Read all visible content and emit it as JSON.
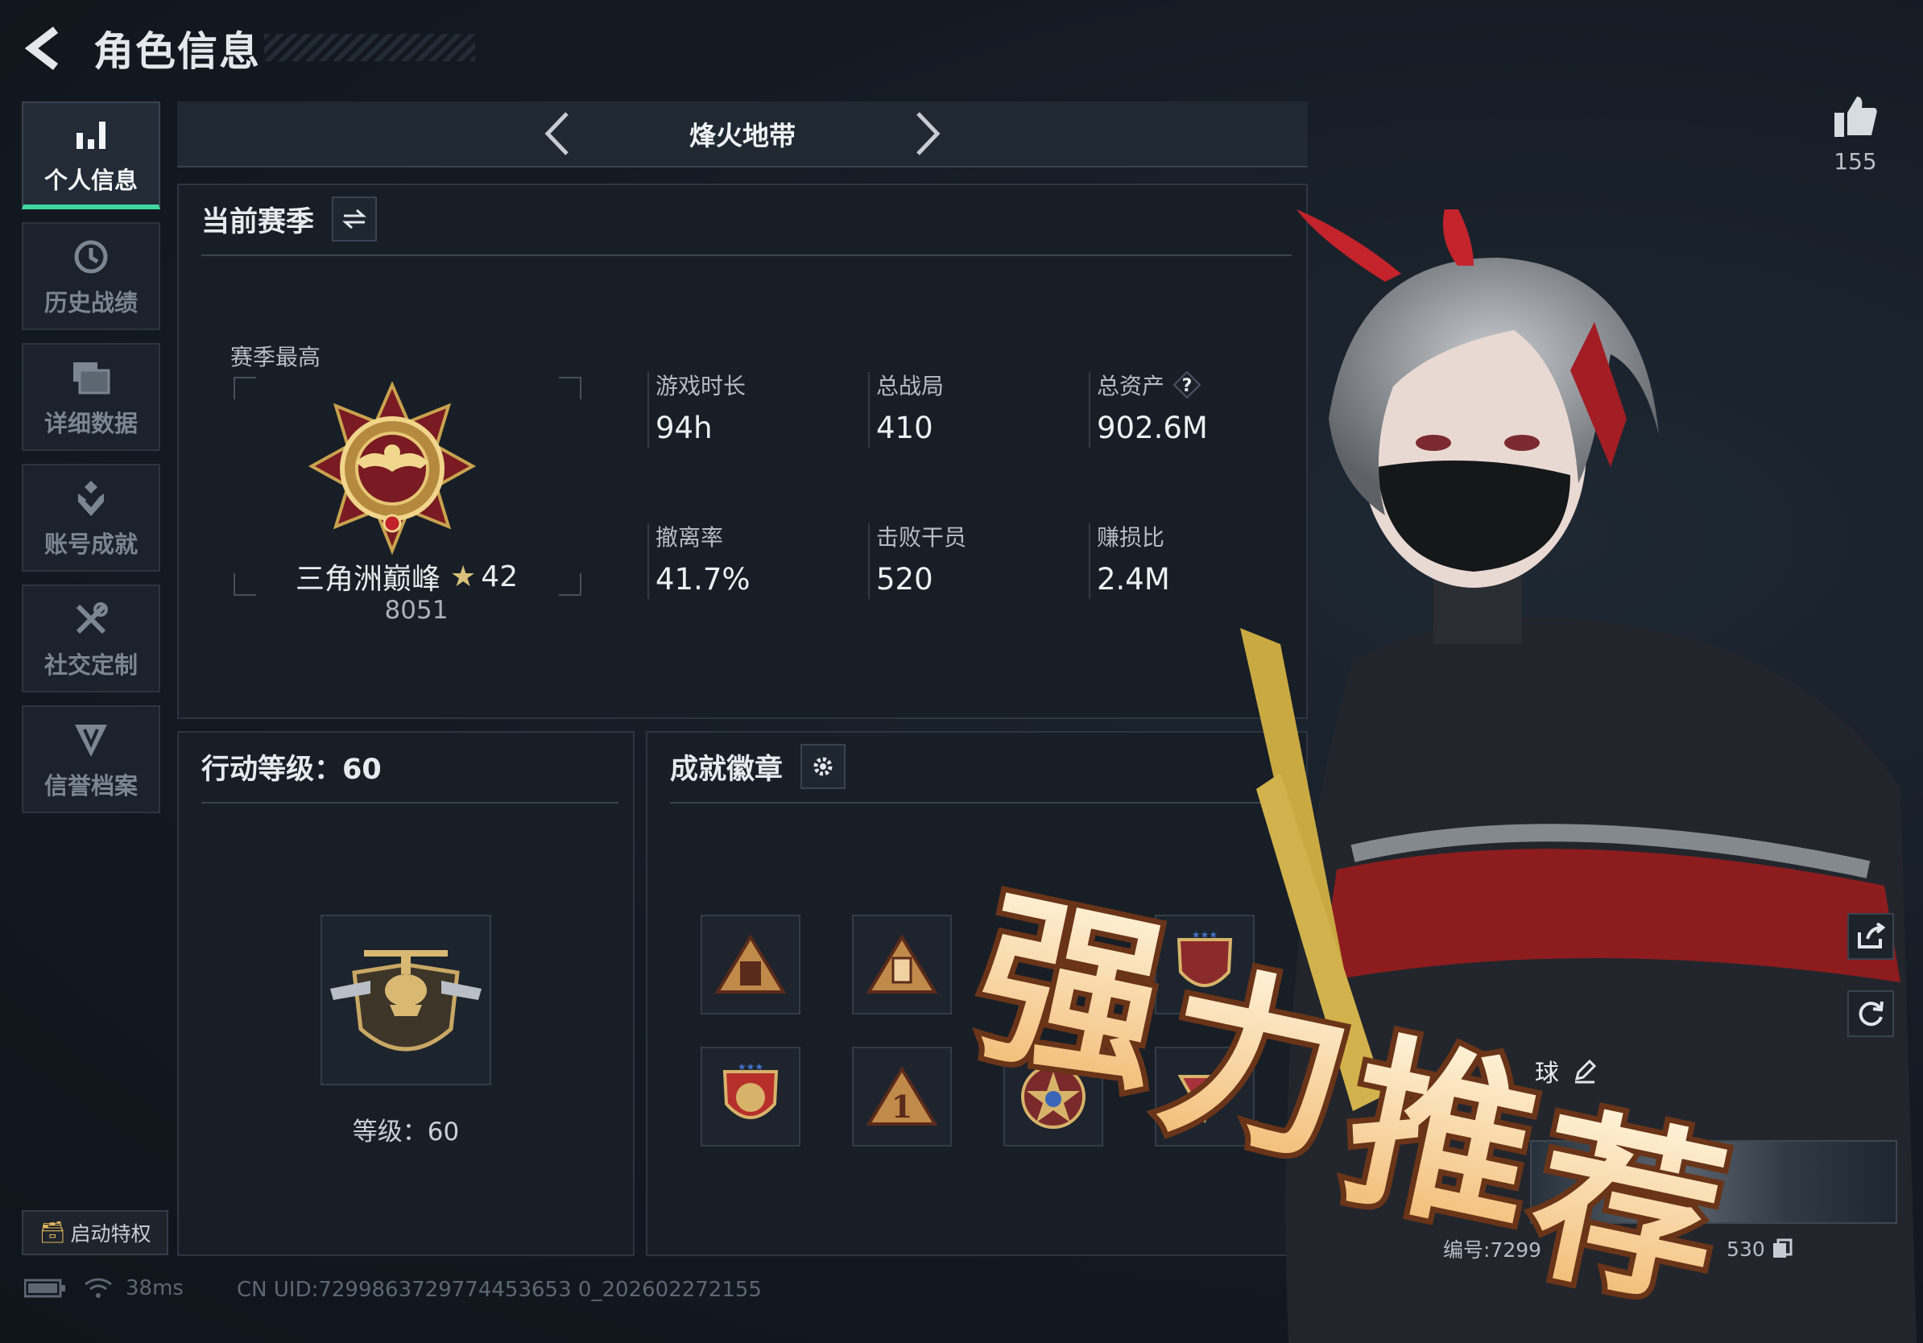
{
  "header": {
    "title": "角色信息"
  },
  "sidebar": {
    "items": [
      {
        "label": "个人信息",
        "icon": "bar-chart-icon",
        "active": true
      },
      {
        "label": "历史战绩",
        "icon": "history-icon",
        "active": false
      },
      {
        "label": "详细数据",
        "icon": "folder-icon",
        "active": false
      },
      {
        "label": "账号成就",
        "icon": "achievement-icon",
        "active": false
      },
      {
        "label": "社交定制",
        "icon": "tools-icon",
        "active": false
      },
      {
        "label": "信誉档案",
        "icon": "shield-icon",
        "active": false
      }
    ],
    "privilege_label": "启动特权"
  },
  "status": {
    "ping": "38ms",
    "uid": "CN UID:7299863729774453653 0_202602272155"
  },
  "mode": {
    "name": "烽火地带"
  },
  "season": {
    "title": "当前赛季",
    "best_label": "赛季最高",
    "rank_name": "三角洲巅峰",
    "rank_stars": "42",
    "rank_score": "8051",
    "stats": [
      {
        "label": "游戏时长",
        "value": "94h"
      },
      {
        "label": "总战局",
        "value": "410"
      },
      {
        "label": "总资产",
        "value": "902.6M",
        "help": "?"
      },
      {
        "label": "撤离率",
        "value": "41.7%"
      },
      {
        "label": "击败干员",
        "value": "520"
      },
      {
        "label": "赚损比",
        "value": "2.4M"
      }
    ]
  },
  "level": {
    "title": "行动等级：60",
    "level_text": "等级：60"
  },
  "achievements": {
    "title": "成就徽章"
  },
  "social": {
    "likes": "155"
  },
  "card": {
    "name": "球",
    "id_prefix": "编号:7299",
    "id_suffix": "530"
  },
  "promo": {
    "text": "强力推荐"
  },
  "colors": {
    "accent": "#3fd6a0",
    "gold": "#d8c079",
    "promo_fill": "#f5c88a",
    "promo_stroke": "#7a3a18"
  }
}
